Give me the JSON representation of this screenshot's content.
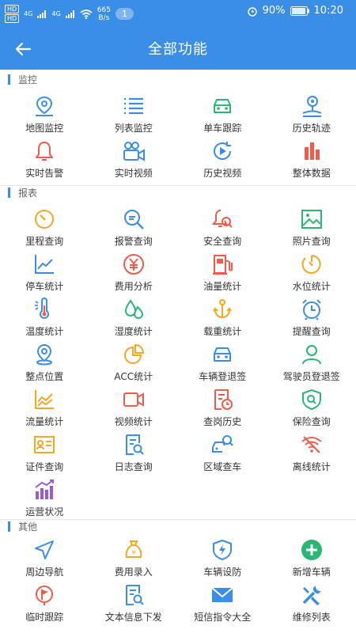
{
  "status": {
    "network_speed": "665",
    "speed_unit": "B/s",
    "notifications": "1",
    "battery": "90%",
    "time": "10:20",
    "hd1": "HD",
    "hd2": "HD",
    "signal1": "4G",
    "signal2": "4G"
  },
  "header": {
    "title": "全部功能"
  },
  "sections": [
    {
      "title": "监控",
      "items": [
        {
          "label": "地图监控",
          "icon": "map-pin",
          "color": "#3a8ee6"
        },
        {
          "label": "列表监控",
          "icon": "list",
          "color": "#3a8ee6"
        },
        {
          "label": "单车跟踪",
          "icon": "car",
          "color": "#2bb673"
        },
        {
          "label": "历史轨迹",
          "icon": "track",
          "color": "#3a8ee6"
        },
        {
          "label": "实时告警",
          "icon": "bell",
          "color": "#f25a4a"
        },
        {
          "label": "实时视频",
          "icon": "camera-group",
          "color": "#3a8ee6"
        },
        {
          "label": "历史视频",
          "icon": "replay",
          "color": "#3a8ee6"
        },
        {
          "label": "整体数据",
          "icon": "bar-chart",
          "color": "#f25a4a"
        }
      ]
    },
    {
      "title": "报表",
      "items": [
        {
          "label": "里程查询",
          "icon": "gauge",
          "color": "#f5a623"
        },
        {
          "label": "报警查询",
          "icon": "search",
          "color": "#3a8ee6"
        },
        {
          "label": "安全查询",
          "icon": "bell-search",
          "color": "#f25a4a"
        },
        {
          "label": "照片查询",
          "icon": "photo",
          "color": "#2bb673"
        },
        {
          "label": "停车统计",
          "icon": "line-chart",
          "color": "#3a8ee6"
        },
        {
          "label": "费用分析",
          "icon": "yen",
          "color": "#f25a4a"
        },
        {
          "label": "油量统计",
          "icon": "fuel",
          "color": "#f25a4a"
        },
        {
          "label": "水位统计",
          "icon": "dial",
          "color": "#f5a623"
        },
        {
          "label": "温度统计",
          "icon": "thermometer",
          "color": "#3a8ee6"
        },
        {
          "label": "湿度统计",
          "icon": "drops",
          "color": "#2bb673"
        },
        {
          "label": "载重统计",
          "icon": "anchor",
          "color": "#f5a623"
        },
        {
          "label": "提醒查询",
          "icon": "alarm",
          "color": "#3a8ee6"
        },
        {
          "label": "整点位置",
          "icon": "pin",
          "color": "#3a8ee6"
        },
        {
          "label": "ACC统计",
          "icon": "pie",
          "color": "#f5a623"
        },
        {
          "label": "车辆登退签",
          "icon": "car",
          "color": "#3a8ee6"
        },
        {
          "label": "驾驶员登退签",
          "icon": "user",
          "color": "#2bb673"
        },
        {
          "label": "流量统计",
          "icon": "area-chart",
          "color": "#f5a623"
        },
        {
          "label": "视频统计",
          "icon": "video",
          "color": "#f25a4a"
        },
        {
          "label": "查岗历史",
          "icon": "doc-clock",
          "color": "#f25a4a"
        },
        {
          "label": "保险查询",
          "icon": "shield-search",
          "color": "#2bb673"
        },
        {
          "label": "证件查询",
          "icon": "id-card",
          "color": "#f5a623"
        },
        {
          "label": "日志查询",
          "icon": "doc-search",
          "color": "#3a8ee6"
        },
        {
          "label": "区域查车",
          "icon": "car-search",
          "color": "#3a8ee6"
        },
        {
          "label": "离线统计",
          "icon": "wifi-off",
          "color": "#f25a4a"
        },
        {
          "label": "运营状况",
          "icon": "growth",
          "color": "#9b59d6"
        }
      ]
    },
    {
      "title": "其他",
      "items": [
        {
          "label": "周边导航",
          "icon": "navigate",
          "color": "#3a8ee6"
        },
        {
          "label": "费用录入",
          "icon": "money-bag",
          "color": "#f5a623"
        },
        {
          "label": "车辆设防",
          "icon": "shield-bolt",
          "color": "#3a8ee6"
        },
        {
          "label": "新增车辆",
          "icon": "plus-circle",
          "color": "#2bb673"
        },
        {
          "label": "临时跟踪",
          "icon": "flag-pin",
          "color": "#f25a4a"
        },
        {
          "label": "文本信息下发",
          "icon": "doc-search",
          "color": "#3a8ee6"
        },
        {
          "label": "短信指令大全",
          "icon": "mail",
          "color": "#3a8ee6"
        },
        {
          "label": "维修列表",
          "icon": "tools",
          "color": "#3a8ee6"
        }
      ]
    }
  ]
}
